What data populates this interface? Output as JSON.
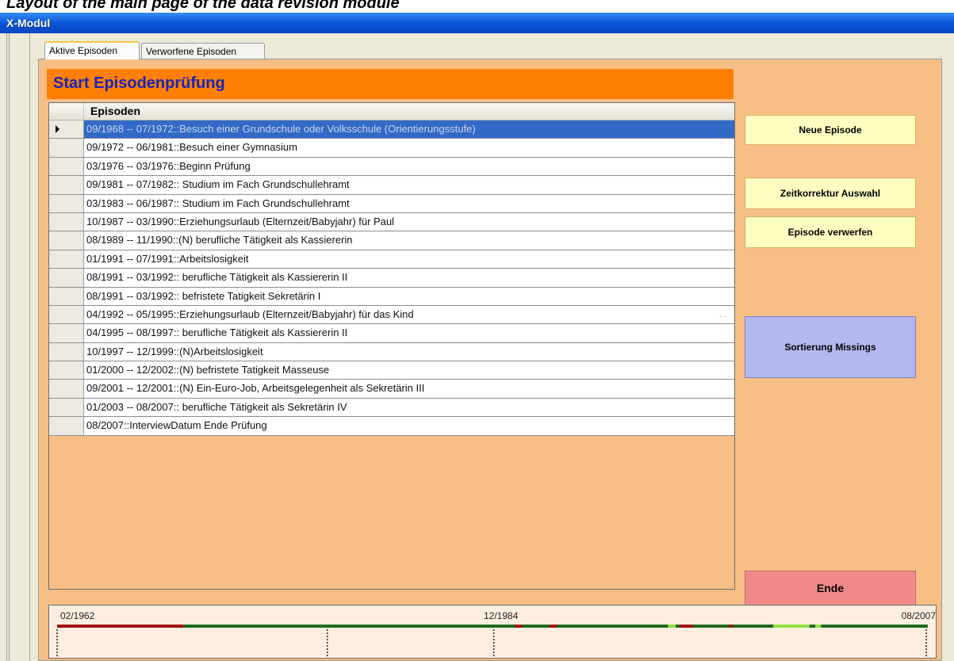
{
  "caption": "Layout of the main page of the data revision module",
  "window": {
    "title": "X-Modul"
  },
  "tabs": [
    {
      "label": "Aktive Episoden",
      "active": true
    },
    {
      "label": "Verworfene Episoden",
      "active": false
    }
  ],
  "header": {
    "title": "Start Episodenprüfung"
  },
  "grid": {
    "column_header": "Episoden",
    "selected_index": 0,
    "rows": [
      "09/1968 -- 07/1972::Besuch einer Grundschule oder Volksschule (Orientierungsstufe)",
      "09/1972 -- 06/1981::Besuch einer Gymnasium",
      "03/1976 -- 03/1976::Beginn Prüfung",
      "09/1981 -- 07/1982:: Studium im Fach Grundschullehramt",
      "03/1983 -- 06/1987:: Studium im Fach Grundschullehramt",
      "10/1987 -- 03/1990::Erziehungsurlaub (Elternzeit/Babyjahr) für Paul",
      "08/1989 -- 11/1990::(N) berufliche Tätigkeit als Kassiererin",
      "01/1991 -- 07/1991::Arbeitslosigkeit",
      "08/1991 -- 03/1992:: berufliche Tätigkeit als Kassiererin II",
      "08/1991 -- 03/1992:: befristete Tatigkeit Sekretärin I",
      "04/1992 -- 05/1995::Erziehungsurlaub (Elternzeit/Babyjahr) für das Kind",
      "04/1995 -- 08/1997:: berufliche Tätigkeit als Kassiererin II",
      "10/1997 -- 12/1999::(N)Arbeitslosigkeit",
      "01/2000 -- 12/2002::(N) befristete Tatigkeit Masseuse",
      "09/2001 -- 12/2001::(N) Ein-Euro-Job, Arbeitsgelegenheit als Sekretärin III",
      "01/2003 -- 08/2007:: berufliche Tätigkeit als Sekretärin IV",
      "08/2007::InterviewDatum Ende Prüfung"
    ],
    "ellipsis": "..."
  },
  "buttons": {
    "neue_episode": "Neue Episode",
    "zeitkorrektur": "Zeitkorrektur Auswahl",
    "verwerfen": "Episode verwerfen",
    "sortierung": "Sortierung Missings",
    "ende": "Ende"
  },
  "colors": {
    "header_bg": "#ff8000",
    "header_text": "#1a23b8",
    "panel_bg": "#f7bf86",
    "selected_row": "#3169c6",
    "button_yellow": "#ffffc2",
    "button_blue": "#b4b8f0",
    "button_red": "#f08a8a",
    "timeline_green": "#1e6b1e",
    "timeline_red": "#a01414",
    "timeline_lightgreen": "#8fe03c"
  },
  "timeline": {
    "start_label": "02/1962",
    "mid_label": "12/1984",
    "end_label": "08/2007",
    "start_year": 1962.08,
    "end_year": 2007.58,
    "segments": [
      {
        "from": 1962.08,
        "to": 1968.7,
        "color": "red"
      },
      {
        "from": 1968.7,
        "to": 1995.0,
        "color": "green"
      },
      {
        "from": 1995.0,
        "to": 1999.5,
        "color": "green"
      },
      {
        "from": 1999.5,
        "to": 2002.0,
        "color": "lightgreen"
      },
      {
        "from": 2002.0,
        "to": 2007.58,
        "color": "green"
      }
    ],
    "markers": [
      {
        "from": 1986.0,
        "to": 1986.4,
        "color": "red"
      },
      {
        "from": 1987.8,
        "to": 1988.2,
        "color": "red"
      },
      {
        "from": 1994.0,
        "to": 1994.4,
        "color": "lightgreen"
      },
      {
        "from": 1994.6,
        "to": 1995.3,
        "color": "red"
      },
      {
        "from": 1997.2,
        "to": 1997.4,
        "color": "red"
      },
      {
        "from": 2001.4,
        "to": 2001.7,
        "color": "green"
      }
    ],
    "ticks": [
      1962.08,
      1976.2,
      1984.9,
      2007.5
    ]
  }
}
